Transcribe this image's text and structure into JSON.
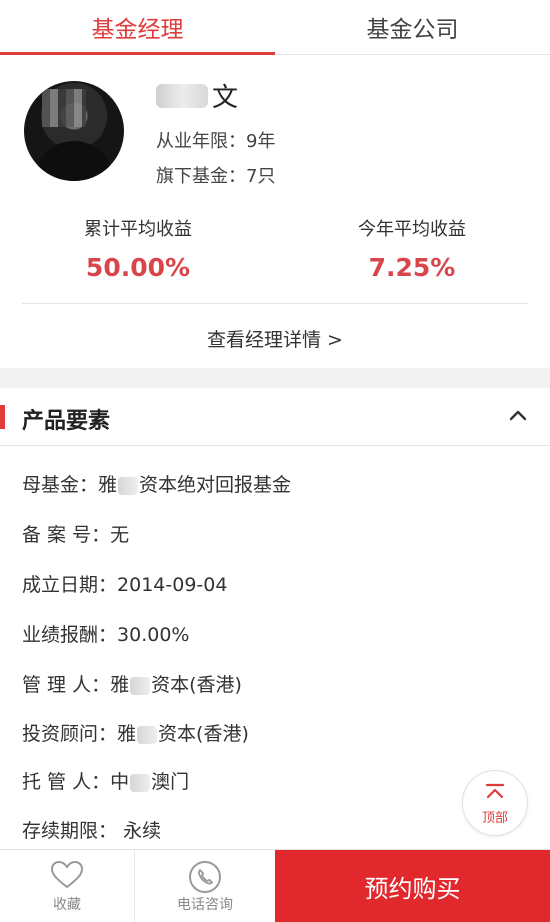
{
  "tabs": [
    {
      "label": "基金经理",
      "active": true
    },
    {
      "label": "基金公司",
      "active": false
    }
  ],
  "manager": {
    "name_visible": "文",
    "years_label": "从业年限：",
    "years_value": "9年",
    "funds_label": "旗下基金：",
    "funds_value": "7只",
    "stats": {
      "cumulative_label": "累计平均收益",
      "cumulative_value": "50.00%",
      "this_year_label": "今年平均收益",
      "this_year_value": "7.25%"
    },
    "detail_link": "查看经理详情 >"
  },
  "product": {
    "section_title": "产品要素",
    "fields": {
      "mother_fund_label": "母基金：",
      "mother_fund_prefix": "雅",
      "mother_fund_suffix": "资本绝对回报基金",
      "record_label": "备 案 号：",
      "record_value": "无",
      "established_label": "成立日期：",
      "established_value": "2014-09-04",
      "performance_fee_label": "业绩报酬：",
      "performance_fee_value": "30.00%",
      "manager_label": "管 理 人：",
      "manager_prefix": "雅",
      "manager_suffix": "资本(香港)",
      "advisor_label": "投资顾问：",
      "advisor_prefix": "雅",
      "advisor_suffix": "资本(香港)",
      "custodian_label": "托 管 人：",
      "custodian_prefix": "中",
      "custodian_suffix": "澳门",
      "duration_label": "存续期限：",
      "duration_value": "永续"
    }
  },
  "top_button": {
    "label": "顶部"
  },
  "bottom_bar": {
    "favorite_label": "收藏",
    "phone_label": "电话咨询",
    "buy_label": "预约购买"
  },
  "colors": {
    "accent": "#e03c3c",
    "buy_button": "#e0282d",
    "stat_value": "#d8454a"
  }
}
